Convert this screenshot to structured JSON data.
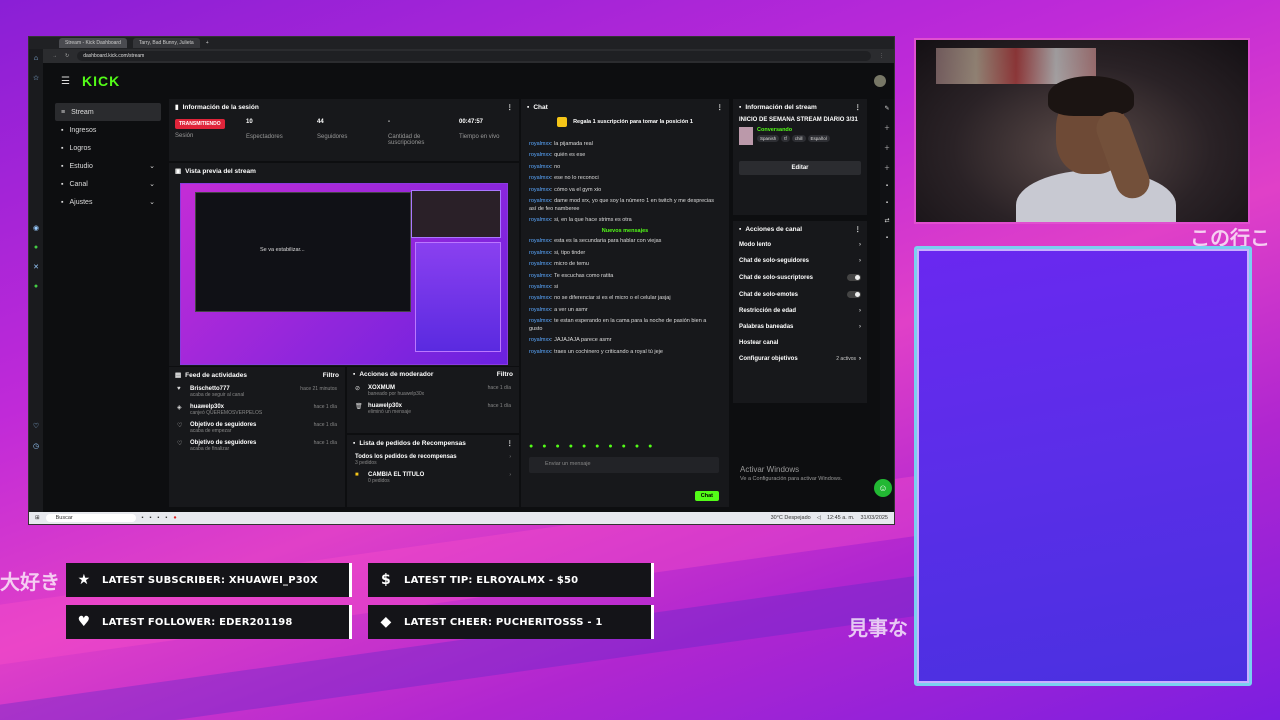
{
  "browser": {
    "tabs": [
      {
        "label": "Stream - Kick Dashboard",
        "active": true
      },
      {
        "label": "Tarry, Bad Bunny, Julieta",
        "active": false
      }
    ],
    "url": "dashboard.kick.com/stream"
  },
  "kick": {
    "logo": "KICK",
    "nav": [
      {
        "label": "Stream",
        "icon": "list-icon",
        "active": true,
        "chevron": false
      },
      {
        "label": "Ingresos",
        "icon": "wallet-icon",
        "active": false,
        "chevron": false
      },
      {
        "label": "Logros",
        "icon": "trophy-icon",
        "active": false,
        "chevron": false
      },
      {
        "label": "Estudio",
        "icon": "studio-icon",
        "active": false,
        "chevron": true
      },
      {
        "label": "Canal",
        "icon": "channel-icon",
        "active": false,
        "chevron": true
      },
      {
        "label": "Ajustes",
        "icon": "gear-icon",
        "active": false,
        "chevron": true
      }
    ],
    "session": {
      "title": "Información de la sesión",
      "badge": "TRANSMITIENDO",
      "badge_label": "Sesión",
      "stats": [
        {
          "value": "10",
          "label": "Espectadores"
        },
        {
          "value": "44",
          "label": "Seguidores"
        },
        {
          "value": "-",
          "label": "Cantidad de suscripciones"
        },
        {
          "value": "00:47:57",
          "label": "Tiempo en vivo"
        }
      ]
    },
    "preview": {
      "title": "Vista previa del stream",
      "inner_text": "Se va estabilizar..."
    },
    "activity": {
      "title": "Feed de actividades",
      "filter": "Filtro",
      "items": [
        {
          "name": "Brischetto777",
          "sub": "acaba de seguir al canal",
          "time": "hace 21 minutos"
        },
        {
          "name": "huawelp30x",
          "sub": "canjeó QUEREMOSVERPELOS",
          "time": "hace 1 día"
        },
        {
          "name": "Objetivo de seguidores",
          "sub": "acaba de empezar",
          "time": "hace 1 día"
        },
        {
          "name": "Objetivo de seguidores",
          "sub": "acaba de finalizar",
          "time": "hace 1 día"
        }
      ]
    },
    "moderator": {
      "title": "Acciones de moderador",
      "filter": "Filtro",
      "items": [
        {
          "name": "XOXMUM",
          "sub": "baneado por huawelp30x",
          "time": "hace 1 día"
        },
        {
          "name": "huawelp30x",
          "sub": "eliminó un mensaje",
          "time": "hace 1 día"
        }
      ]
    },
    "rewards": {
      "title": "Lista de pedidos de Recompensas",
      "all": "Todos los pedidos de recompensas",
      "all_sub": "3 pedidos",
      "item": "CAMBIA EL TITULO",
      "item_sub": "0 pedidos"
    },
    "chat": {
      "title": "Chat",
      "pinned": "Regala 1 suscripción para tomar la posición 1",
      "messages_old": [
        {
          "user": "royalmxx",
          "text": "la pijamada real"
        },
        {
          "user": "royalmxx",
          "text": "quién es ese"
        },
        {
          "user": "royalmxx",
          "text": "no"
        },
        {
          "user": "royalmxx",
          "text": "ese no lo reconoci"
        },
        {
          "user": "royalmxx",
          "text": "cómo va el gym xio"
        },
        {
          "user": "royalmxx",
          "text": "dame mod xrx, yo que soy la número 1 en twitch y me desprecias así de feo namberee"
        },
        {
          "user": "royalmxx",
          "text": "si, en la que hace strims es otra"
        }
      ],
      "separator": "Nuevos mensajes",
      "messages_new": [
        {
          "user": "royalmxx",
          "text": "esta es la secundaria para hablar con viejas"
        },
        {
          "user": "royalmxx",
          "text": "si, tipo tinder"
        },
        {
          "user": "royalmxx",
          "text": "micro de temu"
        },
        {
          "user": "royalmxx",
          "text": "Te escuchas como ratita"
        },
        {
          "user": "royalmxx",
          "text": "si"
        },
        {
          "user": "royalmxx",
          "text": "no se diferenciar si es el micro o el celular jasjaj"
        },
        {
          "user": "royalmxx",
          "text": "a ver un asmr"
        },
        {
          "user": "royalmxx",
          "text": "te estan esperando en la cama para la noche de pasión bien a gusto"
        },
        {
          "user": "royalmxx",
          "text": "JAJAJAJA parece asmr"
        },
        {
          "user": "royalmxx",
          "text": "traes un cochinero y criticando a royal tú jeje"
        },
        {
          "user": "royalmxx",
          "text": ""
        }
      ],
      "input_placeholder": "Enviar un mensaje",
      "send": "Chat"
    },
    "stream_info": {
      "title": "Información del stream",
      "stream_title": "INICIO DE SEMANA STREAM DIARIO 3/31",
      "category": "Conversando",
      "tags": [
        "Spanish",
        "tf",
        "chill",
        "Español"
      ],
      "edit": "Editar"
    },
    "channel_actions": {
      "title": "Acciones de canal",
      "items": [
        {
          "label": "Modo lento",
          "control": "chevron"
        },
        {
          "label": "Chat de solo-seguidores",
          "control": "chevron"
        },
        {
          "label": "Chat de solo-suscriptores",
          "control": "toggle"
        },
        {
          "label": "Chat de solo-emotes",
          "control": "toggle"
        },
        {
          "label": "Restricción de edad",
          "control": "chevron"
        },
        {
          "label": "Palabras baneadas",
          "control": "chevron"
        },
        {
          "label": "Hostear canal",
          "control": "none"
        },
        {
          "label": "Configurar objetivos",
          "control": "goals",
          "extra": "2 activos"
        }
      ]
    },
    "activate_windows": {
      "title": "Activar Windows",
      "sub": "Ve a Configuración para activar Windows."
    }
  },
  "taskbar": {
    "search": "Buscar",
    "weather": "30°C Despejado",
    "time": "12:45 a. m.",
    "date": "31/03/2025"
  },
  "alerts": [
    {
      "icon": "star-icon",
      "glyph": "★",
      "text": "LATEST SUBSCRIBER: XHUAWEI_P30X"
    },
    {
      "icon": "dollar-icon",
      "glyph": "$",
      "text": "LATEST TIP: ELROYALMX - $50"
    },
    {
      "icon": "heart-icon",
      "glyph": "♥",
      "text": "LATEST FOLLOWER: EDER201198"
    },
    {
      "icon": "diamond-icon",
      "glyph": "◆",
      "text": "LATEST CHEER: PUCHERITOSSS - 1"
    }
  ],
  "overlay_text": {
    "jp1": "大好き",
    "jp2": "この行こ",
    "jp3": "見事な"
  },
  "colors": {
    "kick_green": "#53fc18",
    "live_red": "#e0243a",
    "chat_user": "#5aa8ff"
  }
}
